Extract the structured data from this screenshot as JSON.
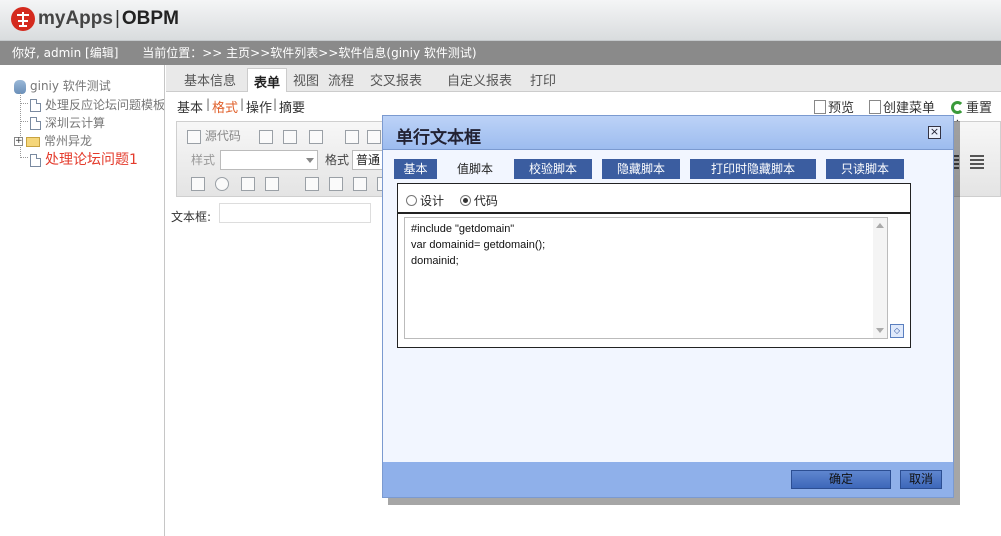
{
  "app": {
    "logo_name": "myApps",
    "logo_suffix": "OBPM",
    "logo_sep": "|"
  },
  "status": {
    "greeting": "你好, admin [编辑]",
    "location": "当前位置：>> 主页>>软件列表>>软件信息(giniy 软件测试)"
  },
  "sidebar": {
    "root": "giniy 软件测试",
    "items": [
      {
        "label": "处理反应论坛问题模板"
      },
      {
        "label": "深圳云计算"
      },
      {
        "label": "常州异龙"
      },
      {
        "label": "处理论坛问题1"
      }
    ]
  },
  "tabs": {
    "items": [
      "基本信息",
      "表单",
      "视图",
      "流程",
      "交叉报表",
      "自定义报表",
      "打印"
    ],
    "active": "表单"
  },
  "subtabs": {
    "items": [
      "基本",
      "格式",
      "操作",
      "摘要"
    ],
    "active": "格式"
  },
  "actions": {
    "preview": "预览",
    "create_menu": "创建菜单",
    "reset": "重置字"
  },
  "editor": {
    "source_code": "源代码",
    "style_label": "样式",
    "format_label": "格式",
    "format_value": "普通",
    "field_label": "文本框:"
  },
  "dialog": {
    "title": "单行文本框",
    "close_glyph": "×",
    "tabs": [
      "基本",
      "值脚本",
      "校验脚本",
      "隐藏脚本",
      "打印时隐藏脚本",
      "只读脚本"
    ],
    "active_tab": "值脚本",
    "radio_design": "设计",
    "radio_code": "代码",
    "selected_mode": "代码",
    "code_lines": [
      "#include \"getdomain\"",
      "var domainid= getdomain();",
      "domainid;"
    ],
    "ok": "确定",
    "cancel": "取消"
  },
  "colors": {
    "dialog_tab_bg": "#3b5da0",
    "dialog_titlebar": "#9dbcef",
    "active_tree_item": "#e43b2c",
    "active_subtab": "#e0602b"
  }
}
